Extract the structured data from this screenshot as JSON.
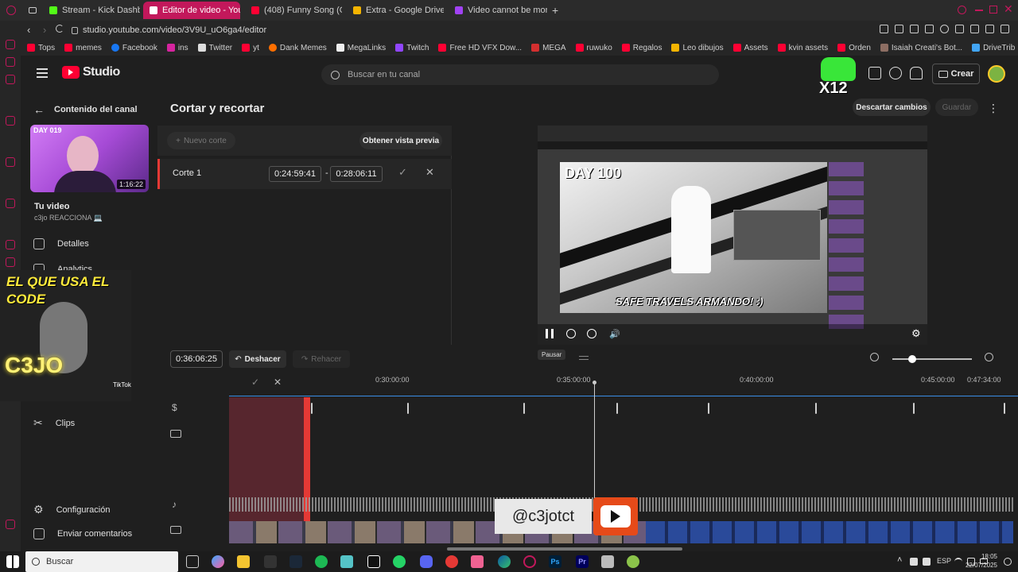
{
  "tabs": [
    {
      "label": "Stream - Kick Dashboard",
      "color": "#53fc18"
    },
    {
      "label": "Editor de video - You",
      "color": "#ff0033",
      "active": true
    },
    {
      "label": "(408) Funny Song (Origin",
      "color": "#ff0033"
    },
    {
      "label": "Extra - Google Drive",
      "color": "#f4b400"
    },
    {
      "label": "Video cannot be monetiz",
      "color": "#a142f4"
    }
  ],
  "url": "studio.youtube.com/video/3V9U_uO6ga4/editor",
  "bookmarks": [
    "Tops",
    "memes",
    "Facebook",
    "ins",
    "Twitter",
    "yt",
    "Dank Memes",
    "MegaLinks",
    "Twitch",
    "Free HD VFX Dow...",
    "MEGA",
    "ruwuko",
    "Regalos",
    "Leo dibujos",
    "Assets",
    "kvin assets",
    "Orden",
    "Isaiah Creati's Bot...",
    "DriveTrib"
  ],
  "header": {
    "logo_text": "Studio",
    "search_placeholder": "Buscar en tu canal",
    "create_label": "Crear"
  },
  "sidebar": {
    "back_label": "Contenido del canal",
    "thumb_badge": "DAY 019",
    "thumb_duration": "1:16:22",
    "video_title": "Tu video",
    "video_subtitle": "c3jo REACCIONA 💻",
    "items": [
      {
        "label": "Detalles",
        "icon": "pencil-icon"
      },
      {
        "label": "Analytics",
        "icon": "analytics-icon"
      },
      {
        "label": "Clips",
        "icon": "scissors-icon"
      },
      {
        "label": "Configuración",
        "icon": "gear-icon"
      },
      {
        "label": "Enviar comentarios",
        "icon": "feedback-icon"
      }
    ]
  },
  "overlay": {
    "code_text": "EL QUE USA EL CODE",
    "code_value": "C3JO",
    "tiktok": "TikTok",
    "handle": "@c3jotct",
    "x12": "X12"
  },
  "editor": {
    "title": "Cortar y recortar",
    "discard_label": "Descartar cambios",
    "save_label": "Guardar",
    "new_cut_label": "Nuevo corte",
    "preview_label": "Obtener vista previa",
    "cut": {
      "label": "Corte 1",
      "start": "0:24:59:41",
      "separator": "-",
      "end": "0:28:06:11"
    },
    "current_time": "0:36:06:25",
    "undo_label": "Deshacer",
    "redo_label": "Rehacer",
    "pause_tooltip": "Pausar",
    "video_caption": "SAFE TRAVELS ARMANDO! :)",
    "video_day": "DAY 100"
  },
  "timeline": {
    "labels": [
      "0:30:00:00",
      "0:35:00:00",
      "0:40:00:00",
      "0:45:00:00",
      "0:47:34:00"
    ]
  },
  "taskbar": {
    "search_label": "Buscar",
    "lang": "ESP",
    "time": "18:05",
    "date": "22/07/2025"
  },
  "colors": {
    "accent": "#c2185b",
    "cut_region": "#6b2a34",
    "playhead": "#e53935",
    "audio": "#9e9e9e"
  }
}
